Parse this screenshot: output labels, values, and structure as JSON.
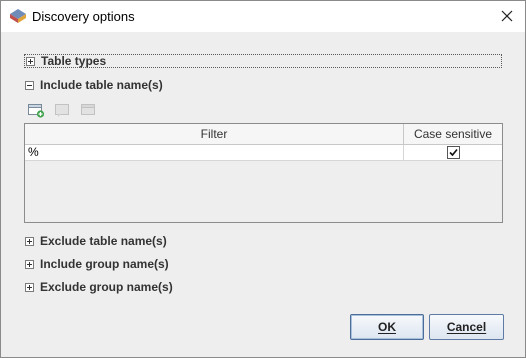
{
  "window": {
    "title": "Discovery options",
    "icon": "app-logo-icon",
    "close_icon": "close-icon"
  },
  "sections": {
    "table_types": {
      "label": "Table types",
      "expanded": false
    },
    "include_table": {
      "label": "Include table name(s)",
      "expanded": true
    },
    "exclude_table": {
      "label": "Exclude table name(s)",
      "expanded": false
    },
    "include_group": {
      "label": "Include group name(s)",
      "expanded": false
    },
    "exclude_group": {
      "label": "Exclude group name(s)",
      "expanded": false
    }
  },
  "toolbar": {
    "buttons": [
      {
        "icon": "add-row-icon",
        "enabled": true
      },
      {
        "icon": "edit-row-icon",
        "enabled": false
      },
      {
        "icon": "delete-row-icon",
        "enabled": false
      }
    ]
  },
  "table": {
    "columns": [
      "Filter",
      "Case sensitive"
    ],
    "rows": [
      {
        "filter": "%",
        "case_sensitive": true
      }
    ]
  },
  "buttons": {
    "ok": "OK",
    "cancel": "Cancel"
  }
}
